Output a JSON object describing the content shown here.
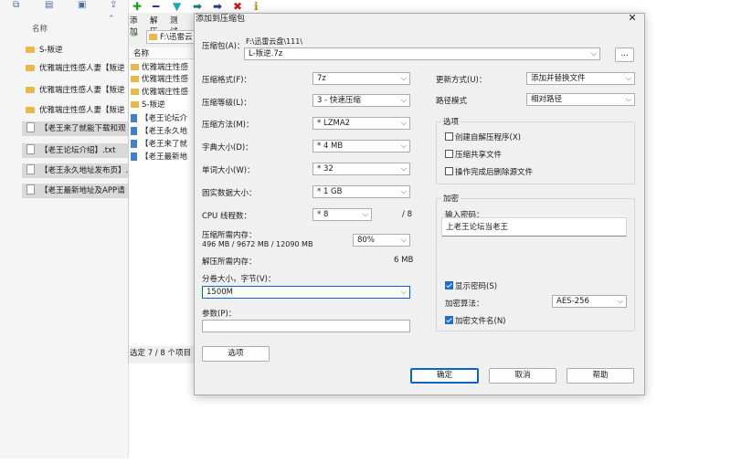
{
  "explorer": {
    "column_name": "名称",
    "files": [
      {
        "name": "S-叛逆",
        "type": "folder"
      },
      {
        "name": "优雅端庄性感人妻【叛逆",
        "type": "folder"
      },
      {
        "name": "优雅端庄性感人妻【叛逆",
        "type": "folder"
      },
      {
        "name": "优雅端庄性感人妻【叛逆",
        "type": "folder"
      },
      {
        "name": "【老王来了就能下载和观",
        "type": "file"
      },
      {
        "name": "【老王论坛介绍】.txt",
        "type": "file"
      },
      {
        "name": "【老王永久地址发布页】.",
        "type": "file"
      },
      {
        "name": "【老王最新地址及APP请",
        "type": "file"
      }
    ]
  },
  "zipwin": {
    "menu": [
      "添加",
      "解压",
      "测试"
    ],
    "address": "F:\\迅雷云",
    "list_header": "名称",
    "rows": [
      {
        "name": "优雅端庄性感",
        "type": "folder"
      },
      {
        "name": "优雅端庄性感",
        "type": "folder"
      },
      {
        "name": "优雅端庄性感",
        "type": "folder"
      },
      {
        "name": "S-叛逆",
        "type": "folder"
      },
      {
        "name": "【老王论坛介",
        "type": "file"
      },
      {
        "name": "【老王永久地",
        "type": "file"
      },
      {
        "name": "【老王来了就",
        "type": "file"
      },
      {
        "name": "【老王最新地",
        "type": "file"
      }
    ],
    "status": "选定 7 / 8 个项目"
  },
  "dialog": {
    "title": "添加到压缩包",
    "archive_label": "压缩包(A)：",
    "archive_path": "F:\\迅雷云盘\\111\\",
    "archive_name": "L-叛逆.7z",
    "browse": "...",
    "format_label": "压缩格式(F)：",
    "format_value": "7z",
    "level_label": "压缩等级(L)：",
    "level_value": "3 - 快速压缩",
    "method_label": "压缩方法(M)：",
    "method_value": "* LZMA2",
    "dict_label": "字典大小(D)：",
    "dict_value": "* 4 MB",
    "word_label": "单词大小(W)：",
    "word_value": "* 32",
    "solid_label": "固实数据大小：",
    "solid_value": "* 1 GB",
    "threads_label": "CPU 线程数：",
    "threads_value": "* 8",
    "threads_total": "/ 8",
    "mem_label": "压缩所需内存：",
    "mem_detail": "496 MB / 9672 MB / 12090 MB",
    "mem_percent": "80%",
    "decomp_label": "解压所需内存：",
    "decomp_value": "6 MB",
    "split_label": "分卷大小，字节(V)：",
    "split_value": "1500M",
    "params_label": "参数(P)：",
    "params_value": "",
    "options_button": "选项",
    "update_label": "更新方式(U)：",
    "update_value": "添加并替换文件",
    "pathmode_label": "路径模式",
    "pathmode_value": "相对路径",
    "options_group": "选项",
    "opt_sfx": "创建自解压程序(X)",
    "opt_shared": "压缩共享文件",
    "opt_delete": "操作完成后删除源文件",
    "encrypt_group": "加密",
    "password_label": "输入密码：",
    "password_value": "上老王论坛当老王",
    "show_password": "显示密码(S)",
    "enc_method_label": "加密算法：",
    "enc_method_value": "AES-256",
    "encrypt_names": "加密文件名(N)",
    "ok": "确定",
    "cancel": "取消",
    "help": "帮助",
    "close": "✕"
  }
}
